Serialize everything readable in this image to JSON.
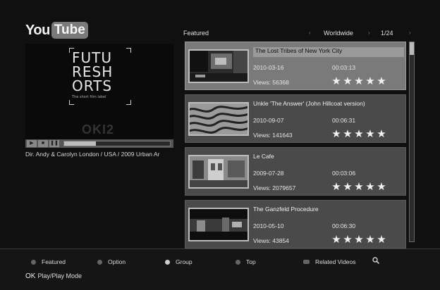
{
  "logo": {
    "part1": "You",
    "part2": "Tube"
  },
  "preview": {
    "brand_lines": [
      "FUTU",
      "RESH",
      "ORTS"
    ],
    "tagline": "The short film label",
    "ghost_text": "OKI2",
    "progress": 0.3,
    "caption": "Dir. Andy & Carolyn London / USA / 2009 Urban Ar"
  },
  "list_header": {
    "category": "Featured",
    "region": "Worldwide",
    "page": "1/24"
  },
  "videos": [
    {
      "title": "The Lost Tribes of New York City",
      "date": "2010-03-16",
      "duration": "00:03:13",
      "views": "Views: 56368",
      "rating": 5,
      "selected": true
    },
    {
      "title": "Unkle 'The Answer' (John Hillcoat version)",
      "date": "2010-09-07",
      "duration": "00:06:31",
      "views": "Views: 141643",
      "rating": 5,
      "selected": false
    },
    {
      "title": "Le Cafe",
      "date": "2009-07-28",
      "duration": "00:03:06",
      "views": "Views: 2079657",
      "rating": 5,
      "selected": false
    },
    {
      "title": "The Ganzfeld Procedure",
      "date": "2010-05-10",
      "duration": "00:06:30",
      "views": "Views: 43854",
      "rating": 5,
      "selected": false
    }
  ],
  "footer": {
    "keys": [
      {
        "label": "Featured"
      },
      {
        "label": "Option"
      },
      {
        "label": "Group"
      },
      {
        "label": "Top"
      },
      {
        "label": "Related Videos"
      }
    ],
    "ok_key": "OK",
    "ok_label": "Play/Play Mode"
  },
  "colors": {
    "background": "#101010",
    "item": "#4a4a4a",
    "selected_item": "#7a7a7a"
  }
}
